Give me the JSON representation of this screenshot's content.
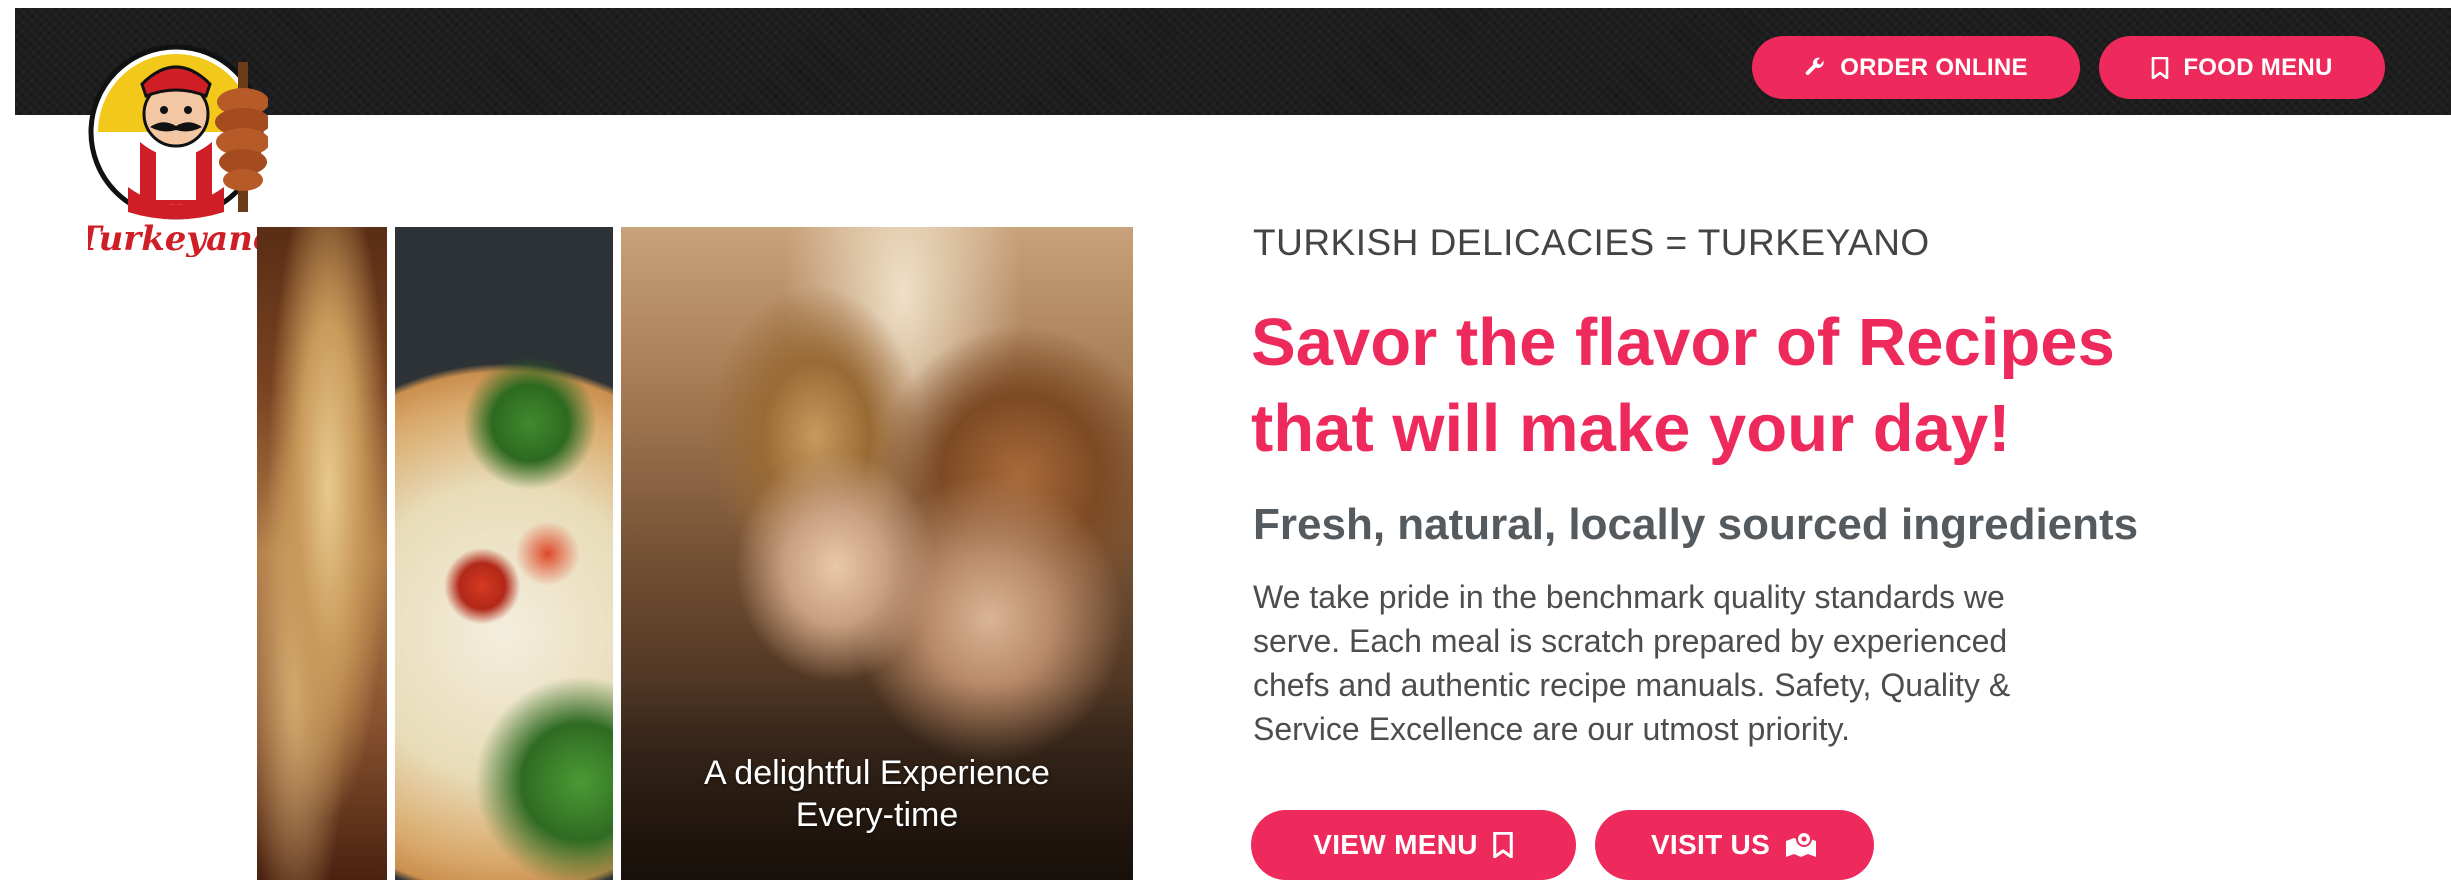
{
  "brand": {
    "logo_text": "Turkeyano"
  },
  "header": {
    "order_online_label": "ORDER ONLINE",
    "food_menu_label": "FOOD MENU"
  },
  "hero": {
    "image_caption_line1": "A delightful Experience",
    "image_caption_line2": "Every-time",
    "eyebrow": "TURKISH DELICACIES = TURKEYANO",
    "headline_line1": "Savor the flavor of Recipes",
    "headline_line2": "that will make your day!",
    "subheadline": "Fresh, natural, locally sourced ingredients",
    "body_line1": "We take pride in the benchmark quality standards we",
    "body_line2": "serve. Each meal is scratch prepared by experienced",
    "body_line3": "chefs and authentic recipe manuals. Safety, Quality &",
    "body_line4": "Service Excellence are our utmost priority.",
    "view_menu_label": "VIEW MENU",
    "visit_us_label": "VISIT US"
  },
  "colors": {
    "accent": "#ee2a5c",
    "topbar": "#1a1a1a",
    "heading_gray": "#555a5f"
  },
  "icons": {
    "order_online": "wrench-icon",
    "food_menu": "bookmark-icon",
    "view_menu": "bookmark-icon",
    "visit_us": "map-marker-icon"
  }
}
